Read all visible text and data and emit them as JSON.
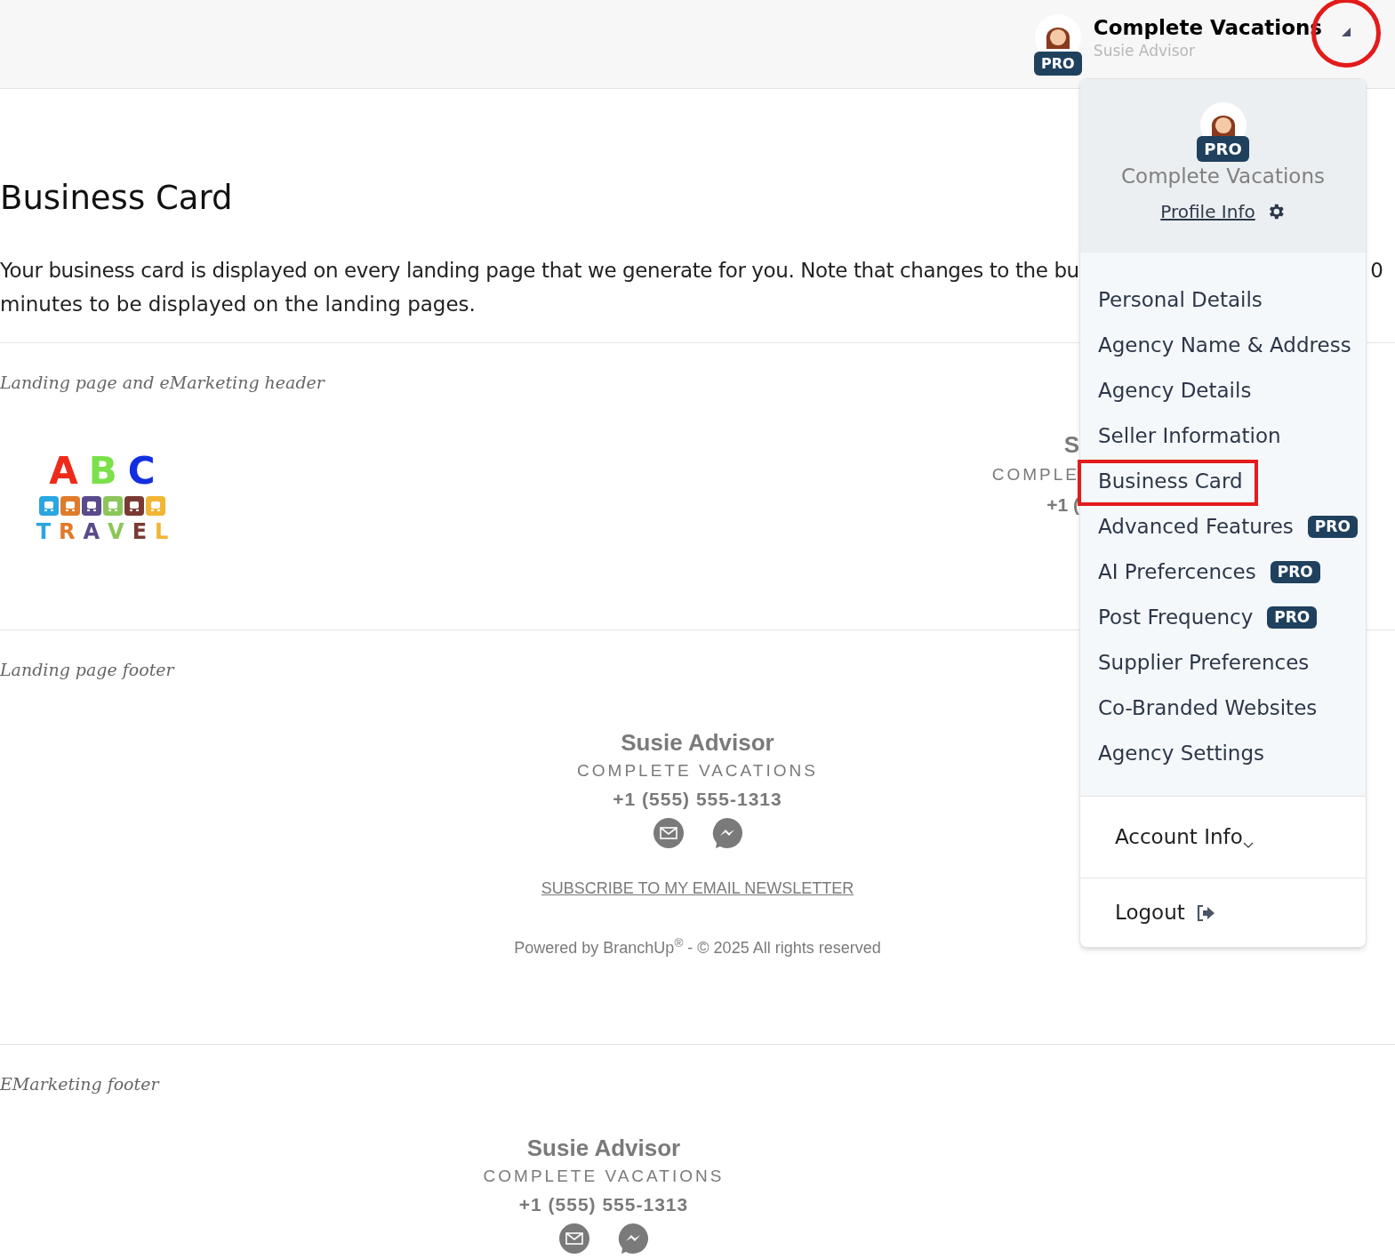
{
  "topbar": {
    "agency": "Complete Vacations",
    "user": "Susie Advisor",
    "badge": "PRO",
    "caret_marked": true
  },
  "page": {
    "title": "Business Card",
    "intro_line_1": "Your business card is displayed on every landing page that we generate for you. Note that changes to the bu",
    "intro_line_1_end": "0",
    "intro_line_2": "minutes to be displayed on the landing pages.",
    "sections": [
      {
        "kind": "header",
        "label": "Landing page and eMarketing header",
        "logo": {
          "top": [
            {
              "ch": "A",
              "color": "#ee2b1b"
            },
            {
              "ch": "B",
              "color": "#7be04a"
            },
            {
              "ch": "C",
              "color": "#1230e0"
            }
          ],
          "tiles": [
            {
              "color": "#2aa6e0"
            },
            {
              "color": "#e07b2a"
            },
            {
              "color": "#5a4a8c"
            },
            {
              "color": "#8cc65a"
            },
            {
              "color": "#7a3a34"
            },
            {
              "color": "#f2b534"
            }
          ],
          "bottom": [
            {
              "ch": "T",
              "color": "#2aa6e0"
            },
            {
              "ch": "R",
              "color": "#e07b2a"
            },
            {
              "ch": "A",
              "color": "#5a4a8c"
            },
            {
              "ch": "V",
              "color": "#8cc65a"
            },
            {
              "ch": "E",
              "color": "#7a3a34"
            },
            {
              "ch": "L",
              "color": "#f2b534"
            }
          ]
        },
        "card_fragments": [
          "S",
          "COMPLE",
          "+1 ("
        ]
      },
      {
        "kind": "footer",
        "label": "Landing page footer",
        "name": "Susie Advisor",
        "company": "COMPLETE VACATIONS",
        "phone": "+1 (555) 555-1313",
        "link": "SUBSCRIBE TO MY EMAIL NEWSLETTER",
        "powered": "Powered by BranchUp$^{®}$ - © 2025 All rights reserved"
      },
      {
        "kind": "email",
        "label": "EMarketing footer",
        "name": "Susie Advisor",
        "company": "COMPLETE VACATIONS",
        "phone": "+1 (555) 555-1313"
      }
    ]
  },
  "dropdown": {
    "badge": "PRO",
    "agency": "Complete Vacations",
    "profile_link": "Profile Info",
    "items": [
      {
        "label": "Personal Details",
        "pro": false,
        "marked": false
      },
      {
        "label": "Agency Name & Address",
        "pro": false,
        "marked": false
      },
      {
        "label": "Agency Details",
        "pro": false,
        "marked": false
      },
      {
        "label": "Seller Information",
        "pro": false,
        "marked": false
      },
      {
        "label": "Business Card",
        "pro": false,
        "marked": true
      },
      {
        "label": "Advanced Features",
        "badge": "PRO",
        "pro": true,
        "marked": false
      },
      {
        "label": "AI Prefercences",
        "badge": "PRO",
        "pro": true,
        "marked": false
      },
      {
        "label": "Post Frequency",
        "badge": "PRO",
        "pro": true,
        "marked": false
      },
      {
        "label": "Supplier Preferences",
        "pro": false,
        "marked": false
      },
      {
        "label": "Co-Branded Websites",
        "pro": false,
        "marked": false
      },
      {
        "label": "Agency Settings",
        "pro": false,
        "marked": false
      }
    ],
    "account": "Account Info",
    "logout": "Logout"
  }
}
